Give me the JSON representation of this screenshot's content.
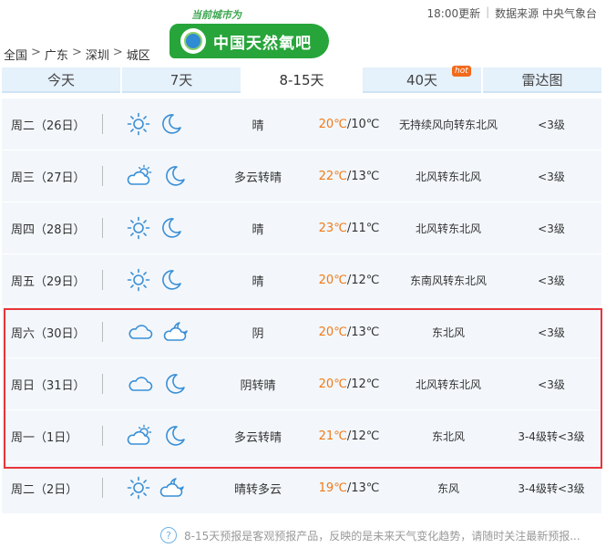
{
  "topbar": {
    "updated": "18:00更新",
    "source": "数据来源 中央气象台"
  },
  "breadcrumb": [
    "全国",
    "广东",
    "深圳",
    "城区"
  ],
  "banner": {
    "subtitle": "当前城市为",
    "title": "中国天然氧吧"
  },
  "tabs": [
    {
      "label": "今天"
    },
    {
      "label": "7天"
    },
    {
      "label": "8-15天",
      "active": true
    },
    {
      "label": "40天",
      "badge": "hot"
    },
    {
      "label": "雷达图"
    }
  ],
  "forecast": [
    {
      "day": "周二（26日）",
      "day_icon": "sun-icon",
      "night_icon": "moon-icon",
      "cond": "晴",
      "high": "20℃",
      "low": "/10℃",
      "wind": "无持续风向转东北风",
      "level": "<3级"
    },
    {
      "day": "周三（27日）",
      "day_icon": "partly-cloudy-icon",
      "night_icon": "moon-icon",
      "cond": "多云转晴",
      "high": "22℃",
      "low": "/13℃",
      "wind": "北风转东北风",
      "level": "<3级"
    },
    {
      "day": "周四（28日）",
      "day_icon": "sun-icon",
      "night_icon": "moon-icon",
      "cond": "晴",
      "high": "23℃",
      "low": "/11℃",
      "wind": "北风转东北风",
      "level": "<3级"
    },
    {
      "day": "周五（29日）",
      "day_icon": "sun-icon",
      "night_icon": "moon-icon",
      "cond": "晴",
      "high": "20℃",
      "low": "/12℃",
      "wind": "东南风转东北风",
      "level": "<3级"
    },
    {
      "day": "周六（30日）",
      "day_icon": "cloud-icon",
      "night_icon": "cloudy-night-icon",
      "cond": "阴",
      "high": "20℃",
      "low": "/13℃",
      "wind": "东北风",
      "level": "<3级"
    },
    {
      "day": "周日（31日）",
      "day_icon": "cloud-icon",
      "night_icon": "moon-icon",
      "cond": "阴转晴",
      "high": "20℃",
      "low": "/12℃",
      "wind": "北风转东北风",
      "level": "<3级"
    },
    {
      "day": "周一（1日）",
      "day_icon": "partly-cloudy-icon",
      "night_icon": "moon-icon",
      "cond": "多云转晴",
      "high": "21℃",
      "low": "/12℃",
      "wind": "东北风",
      "level": "3-4级转<3级"
    },
    {
      "day": "周二（2日）",
      "day_icon": "sun-icon",
      "night_icon": "cloudy-night-icon",
      "cond": "晴转多云",
      "high": "19℃",
      "low": "/13℃",
      "wind": "东风",
      "level": "3-4级转<3级"
    }
  ],
  "footer": {
    "help_icon": "?",
    "note": "8-15天预报是客观预报产品，反映的是未来天气变化趋势，请随时关注最新预报..."
  },
  "colors": {
    "accent": "#27a53a",
    "tab_bg": "#e5f1fb",
    "high_temp": "#f07a18",
    "highlight": "#e8353a",
    "icon": "#3a8fd6"
  }
}
